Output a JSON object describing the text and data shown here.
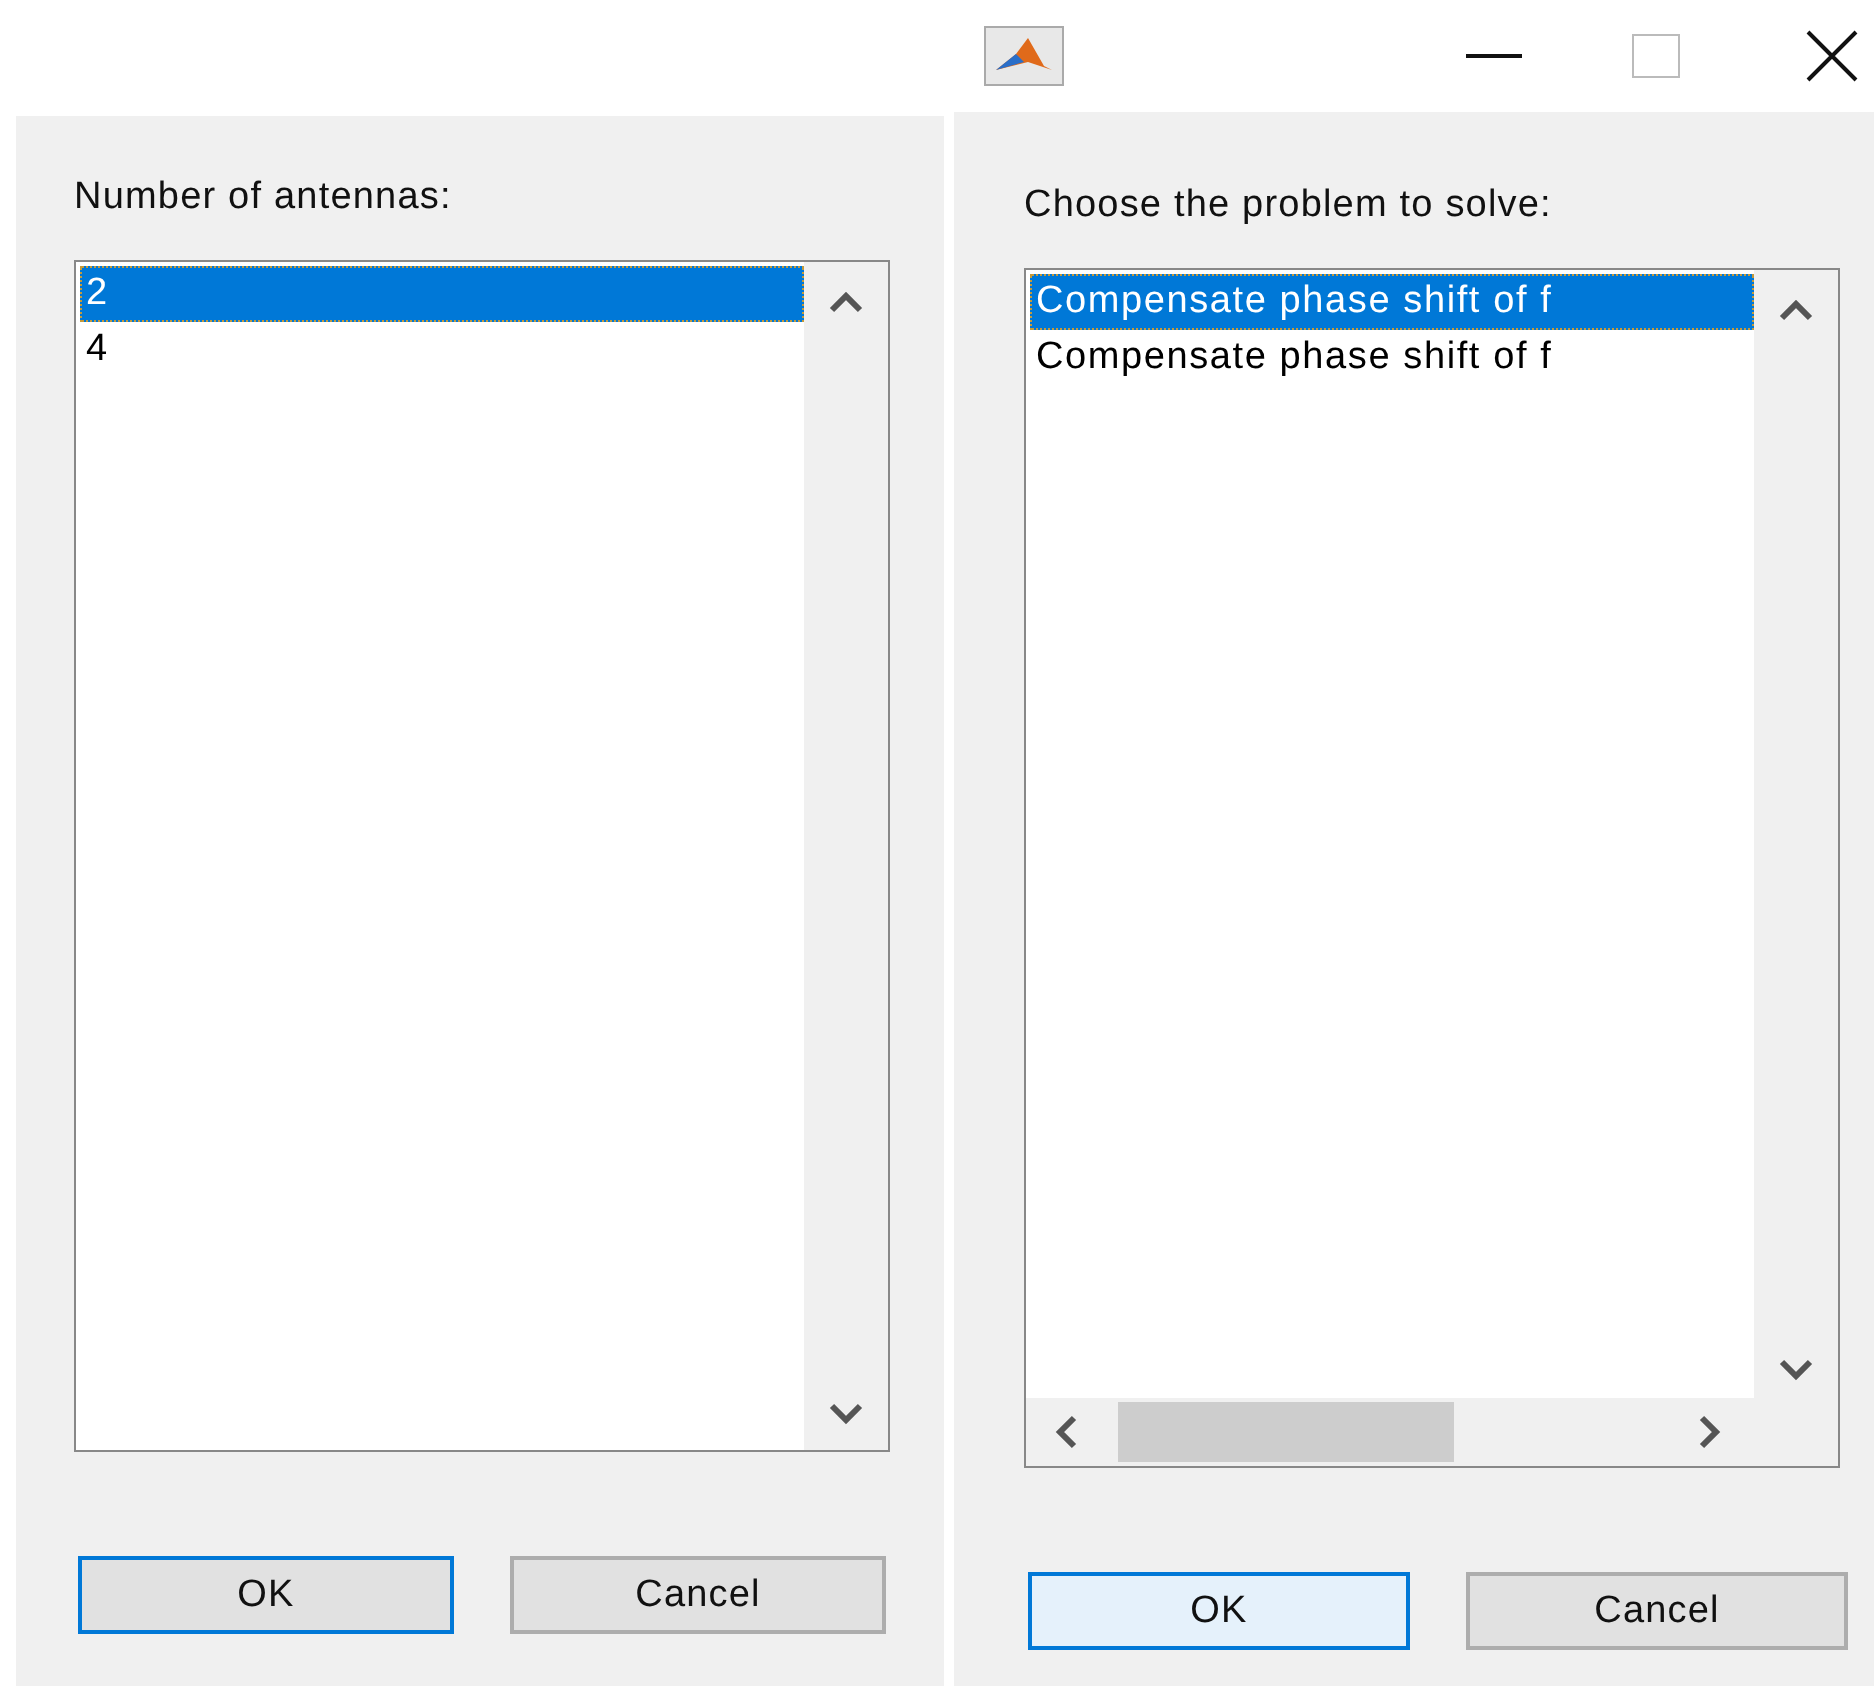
{
  "dialogs": [
    {
      "title_bar": false,
      "prompt": "Number of antennas:",
      "items": [
        {
          "label": "2",
          "selected": true
        },
        {
          "label": "4",
          "selected": false
        }
      ],
      "horizontal_scroll": false,
      "buttons": [
        {
          "label": "OK",
          "default": true,
          "hovered": false
        },
        {
          "label": "Cancel",
          "default": false,
          "hovered": false
        }
      ]
    },
    {
      "title_bar": true,
      "prompt": "Choose the problem to solve:",
      "items": [
        {
          "label": "Compensate phase shift of f",
          "selected": true
        },
        {
          "label": "Compensate phase shift of f",
          "selected": false
        }
      ],
      "horizontal_scroll": true,
      "buttons": [
        {
          "label": "OK",
          "default": true,
          "hovered": true
        },
        {
          "label": "Cancel",
          "default": false,
          "hovered": false
        }
      ]
    }
  ]
}
